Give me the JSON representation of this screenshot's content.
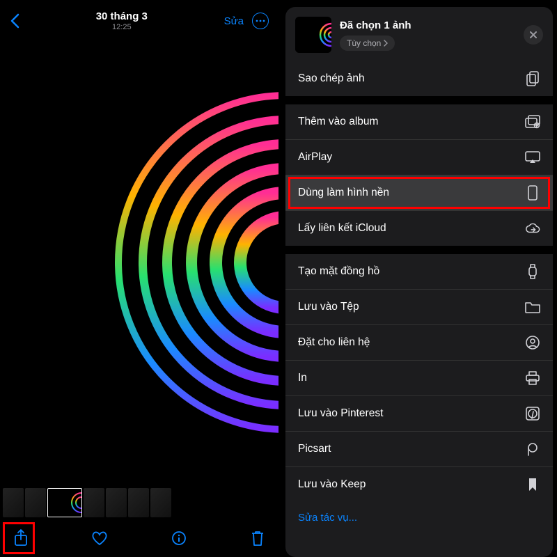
{
  "left": {
    "date": "30 tháng 3",
    "time": "12:25",
    "edit_label": "Sửa"
  },
  "sheet": {
    "title": "Đã chọn 1 ảnh",
    "options_label": "Tùy chọn"
  },
  "groups": [
    {
      "rows": [
        {
          "label": "Sao chép ảnh",
          "icon": "copy"
        }
      ]
    },
    {
      "rows": [
        {
          "label": "Thêm vào album",
          "icon": "album"
        },
        {
          "label": "AirPlay",
          "icon": "airplay"
        },
        {
          "label": "Dùng làm hình nền",
          "icon": "phone",
          "highlight": true
        },
        {
          "label": "Lấy liên kết iCloud",
          "icon": "cloud"
        }
      ]
    },
    {
      "rows": [
        {
          "label": "Tạo mặt đồng hồ",
          "icon": "watch"
        },
        {
          "label": "Lưu vào Tệp",
          "icon": "folder"
        },
        {
          "label": "Đặt cho liên hệ",
          "icon": "contact"
        },
        {
          "label": "In",
          "icon": "print"
        },
        {
          "label": "Lưu vào Pinterest",
          "icon": "pinterest"
        },
        {
          "label": "Picsart",
          "icon": "picsart"
        },
        {
          "label": "Lưu vào Keep",
          "icon": "bookmark"
        }
      ]
    }
  ],
  "edit_actions_label": "Sửa tác vụ..."
}
